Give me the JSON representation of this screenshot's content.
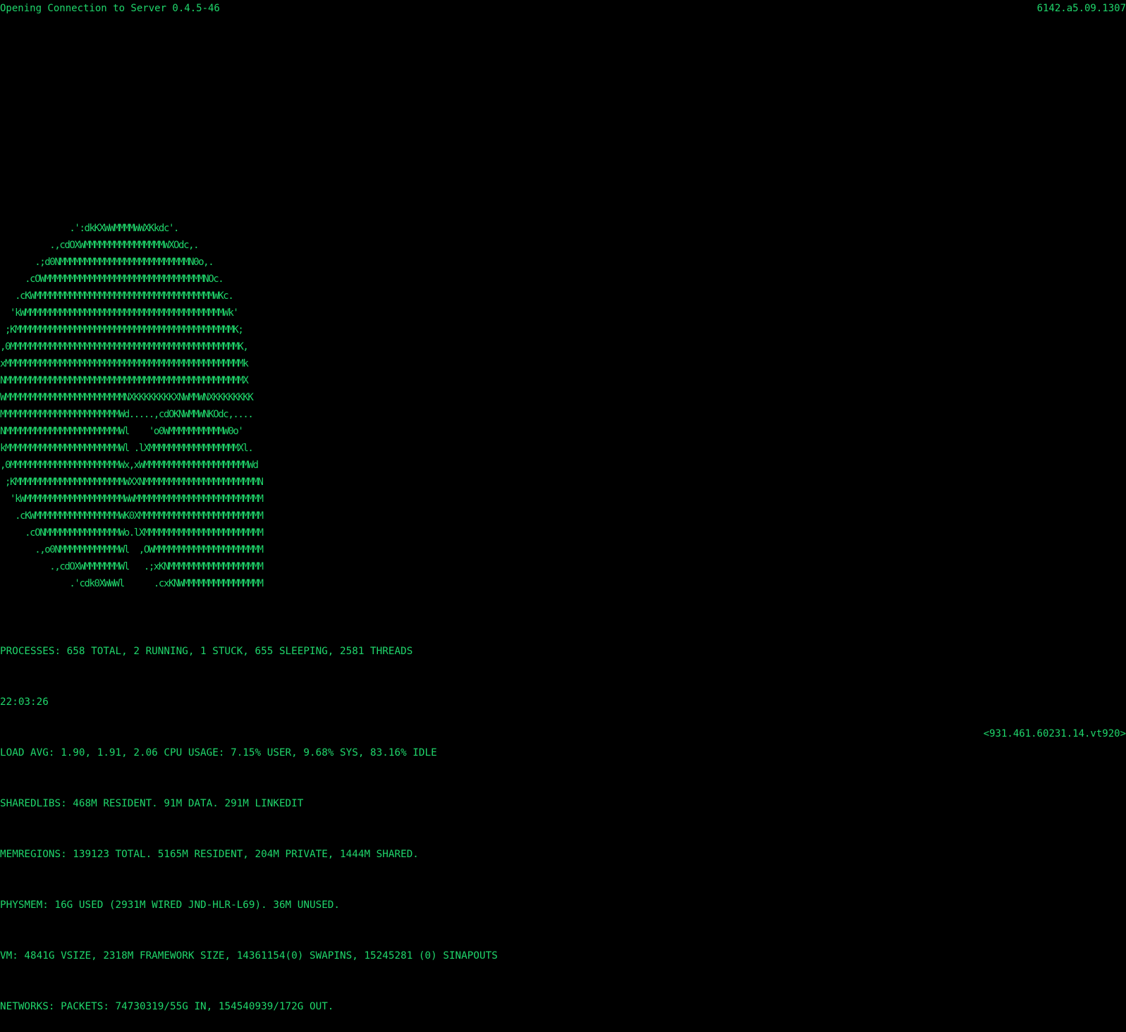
{
  "header": {
    "connection_text": "Opening Connection to Server 0.4.5-46",
    "build_id": "6142.a5.09.1307"
  },
  "ascii_logo": {
    "lines": [
      "              .':dkKXWWMMMMWWXKkdc'.",
      "          .,cdOXWMMMMMMMMMMMMMMMMWXOdc,.",
      "       .;d0NMMMMMMMMMMMMMMMMMMMMMMMMMMN0o,.",
      "     .cOWMMMMMMMMMMMMMMMMMMMMMMMMMMMMMMMMNOc.",
      "   .cKWMMMMMMMMMMMMMMMMMMMMMMMMMMMMMMMMMMMMWKc.",
      "  'kWMMMMMMMMMMMMMMMMMMMMMMMMMMMMMMMMMMMMMMMMWk'",
      " ;KMMMMMMMMMMMMMMMMMMMMMMMMMMMMMMMMMMMMMMMMMMMMK;",
      ",0MMMMMMMMMMMMMMMMMMMMMMMMMMMMMMMMMMMMMMMMMMMMMMK,",
      "xMMMMMMMMMMMMMMMMMMMMMMMMMMMMMMMMMMMMMMMMMMMMMMMMk",
      "NMMMMMMMMMMMMMMMMMMMMMMMMMMMMMMMMMMMMMMMMMMMMMMMMX",
      "WMMMMMMMMMMMMMMMMMMMMMMMMNXKKKKKKKKXNWMMWNXKKKKKKKK",
      "MMMMMMMMMMMMMMMMMMMMMMMMWd.....,cdOKNWMMWNKOdc,....",
      "NMMMMMMMMMMMMMMMMMMMMMMMWl    'o0WMMMMMMMMMMMW0o'",
      "kMMMMMMMMMMMMMMMMMMMMMMMWl .lXMMMMMMMMMMMMMMMMMMXl.",
      ",0MMMMMMMMMMMMMMMMMMMMMMWx,xWMMMMMMMMMMMMMMMMMMMMMWd",
      " ;KMMMMMMMMMMMMMMMMMMMMMMWXXNMMMMMMMMMMMMMMMMMMMMMMMN",
      "  'kWMMMMMMMMMMMMMMMMMMMMWWMMMMMMMMMMMMMMMMMMMMMMMMMM",
      "   .cKWMMMMMMMMMMMMMMMMMWK0XMMMMMMMMMMMMMMMMMMMMMMMMM",
      "     .cONMMMMMMMMMMMMMMMWo.lXMMMMMMMMMMMMMMMMMMMMMMMM",
      "       .,o0NMMMMMMMMMMMMWl  ,OWMMMMMMMMMMMMMMMMMMMMMM",
      "          .,cdOXWMMMMMMMWl   .;xKNMMMMMMMMMMMMMMMMMMM",
      "              .'cdk0XWWWl      .cxKNWMMMMMMMMMMMMMMMM"
    ]
  },
  "status": {
    "processes": "PROCESSES: 658 TOTAL, 2 RUNNING, 1 STUCK, 655 SLEEPING, 2581 THREADS",
    "time": "22:03:26",
    "load": "LOAD AVG: 1.90, 1.91, 2.06 CPU USAGE: 7.15% USER, 9.68% SYS, 83.16% IDLE",
    "sharedlibs": "SHAREDLIBS: 468M RESIDENT. 91M DATA. 291M LINKEDIT",
    "memregions": "MEMREGIONS: 139123 TOTAL. 5165M RESIDENT, 204M PRIVATE, 1444M SHARED.",
    "physmem": "PHYSMEM: 16G USED (2931M WIRED JND-HLR-L69). 36M UNUSED.",
    "vm": "VM: 4841G VSIZE, 2318M FRAMEWORK SIZE, 14361154(0) SWAPINS, 15245281 (0) SINAPOUTS",
    "networks": "NETWORKS: PACKETS: 74730319/55G IN, 154540939/172G OUT."
  },
  "footer": {
    "address": "<931.461.60231.14.vt920>"
  },
  "colors": {
    "background": "#000000",
    "terminal_green": "#1fd66b"
  }
}
